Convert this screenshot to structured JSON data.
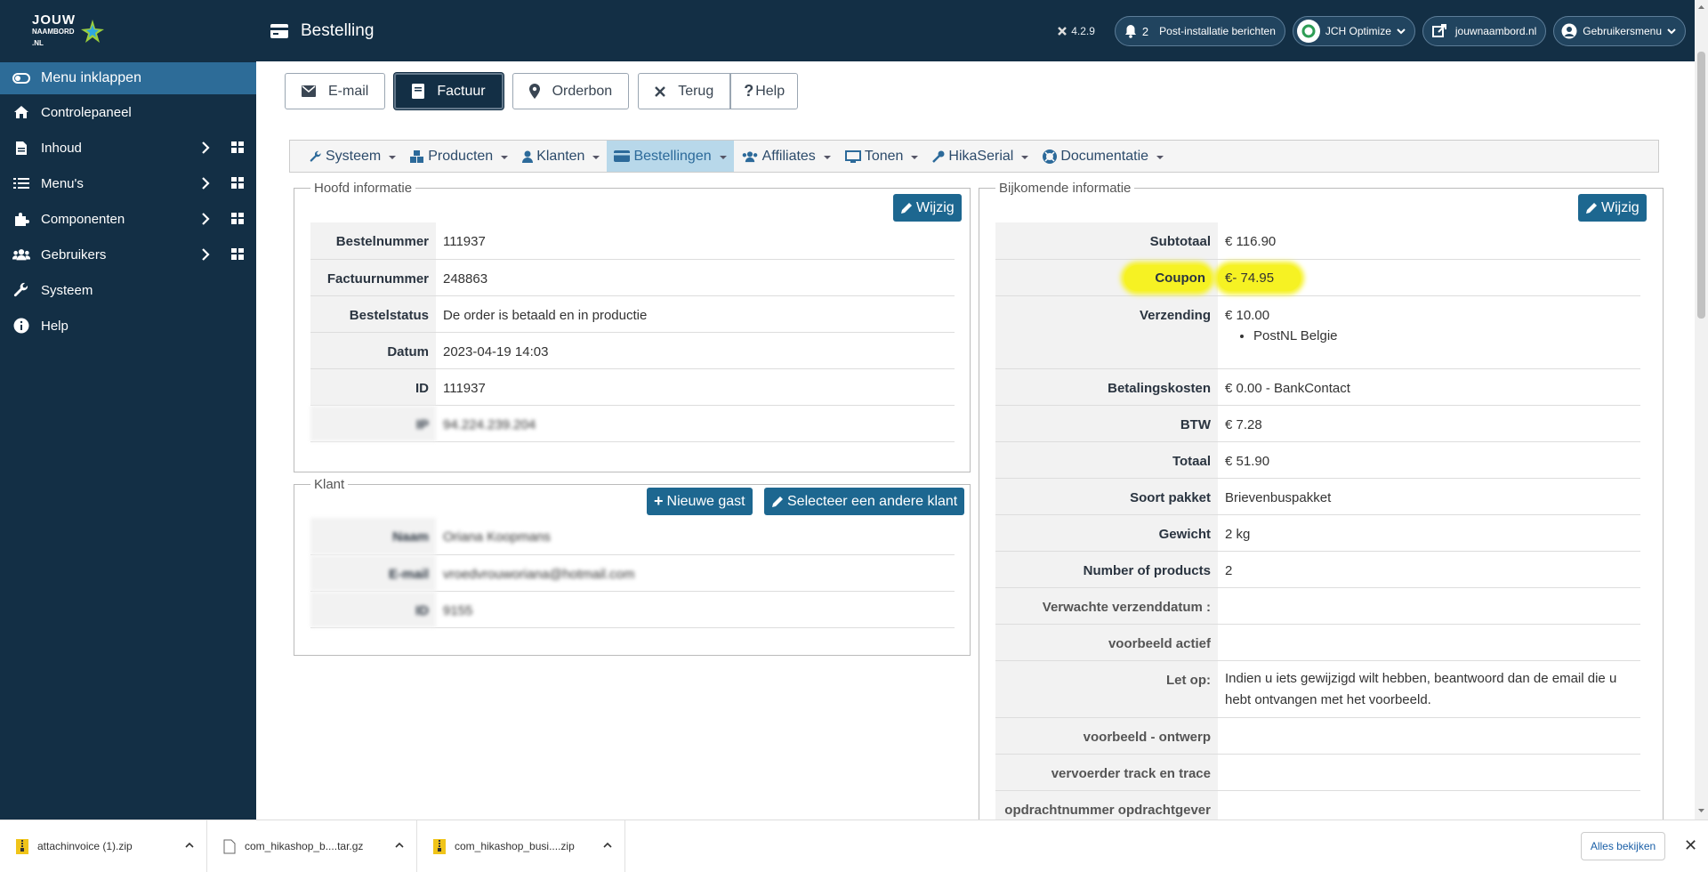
{
  "sidebar": {
    "items": [
      {
        "label": "Menu inklappen",
        "icon": "toggle-icon"
      },
      {
        "label": "Controlepaneel",
        "icon": "home-icon"
      },
      {
        "label": "Inhoud",
        "icon": "file-icon"
      },
      {
        "label": "Menu's",
        "icon": "list-icon"
      },
      {
        "label": "Componenten",
        "icon": "puzzle-icon"
      },
      {
        "label": "Gebruikers",
        "icon": "users-icon"
      },
      {
        "label": "Systeem",
        "icon": "wrench-icon"
      },
      {
        "label": "Help",
        "icon": "info-icon"
      }
    ]
  },
  "topbar": {
    "title": "Bestelling",
    "version": "4.2.9",
    "notifications_count": "2",
    "notifications_label": "Post-installatie berichten",
    "jch_label": "JCH Optimize",
    "site_label": "jouwnaambord.nl",
    "user_label": "Gebruikersmenu"
  },
  "toolbar": {
    "email": "E-mail",
    "factuur": "Factuur",
    "orderbon": "Orderbon",
    "terug": "Terug",
    "help": "Help"
  },
  "hikamenu": {
    "items": [
      "Systeem",
      "Producten",
      "Klanten",
      "Bestellingen",
      "Affiliates",
      "Tonen",
      "HikaSerial",
      "Documentatie"
    ]
  },
  "main_info": {
    "legend": "Hoofd informatie",
    "edit": "Wijzig",
    "rows": [
      {
        "k": "Bestelnummer",
        "v": "111937"
      },
      {
        "k": "Factuurnummer",
        "v": "248863"
      },
      {
        "k": "Bestelstatus",
        "v": "De order is betaald en in productie"
      },
      {
        "k": "Datum",
        "v": "2023-04-19 14:03"
      },
      {
        "k": "ID",
        "v": "111937"
      },
      {
        "k": "IP",
        "v": "94.224.239.204"
      }
    ]
  },
  "customer": {
    "legend": "Klant",
    "new_guest": "Nieuwe gast",
    "select_other": "Selecteer een andere klant",
    "rows": [
      {
        "k": "Naam",
        "v": "Oriana Koopmans"
      },
      {
        "k": "E-mail",
        "v": "vroedvrouworiana@hotmail.com"
      },
      {
        "k": "ID",
        "v": "9155"
      }
    ]
  },
  "extra_info": {
    "legend": "Bijkomende informatie",
    "edit": "Wijzig",
    "rows": [
      {
        "k": "Subtotaal",
        "v": "€ 116.90"
      },
      {
        "k": "Coupon",
        "v": "€- 74.95"
      },
      {
        "k": "Verzending",
        "v": "€ 10.00",
        "sub": "PostNL Belgie"
      },
      {
        "k": "Betalingskosten",
        "v": "€ 0.00 - BankContact"
      },
      {
        "k": "BTW",
        "v": "€ 7.28"
      },
      {
        "k": "Totaal",
        "v": "€ 51.90"
      },
      {
        "k": "Soort pakket",
        "v": "Brievenbuspakket"
      },
      {
        "k": "Gewicht",
        "v": "2 kg"
      },
      {
        "k": "Number of products",
        "v": "2"
      },
      {
        "k": "Verwachte verzenddatum :",
        "v": ""
      },
      {
        "k": "voorbeeld actief",
        "v": ""
      },
      {
        "k": "Let op:",
        "v": "Indien u iets gewijzigd wilt hebben, beantwoord dan de email die u hebt ontvangen met het voorbeeld."
      },
      {
        "k": "voorbeeld - ontwerp",
        "v": ""
      },
      {
        "k": "vervoerder track en trace",
        "v": ""
      },
      {
        "k": "opdrachtnummer opdrachtgever",
        "v": ""
      }
    ]
  },
  "downloads": {
    "items": [
      "attachinvoice (1).zip",
      "com_hikashop_b....tar.gz",
      "com_hikashop_busi....zip"
    ],
    "see_all": "Alles bekijken"
  },
  "colors": {
    "sidebar_bg": "#132f45",
    "accent": "#1d6790",
    "highlight": "#f6f223"
  }
}
